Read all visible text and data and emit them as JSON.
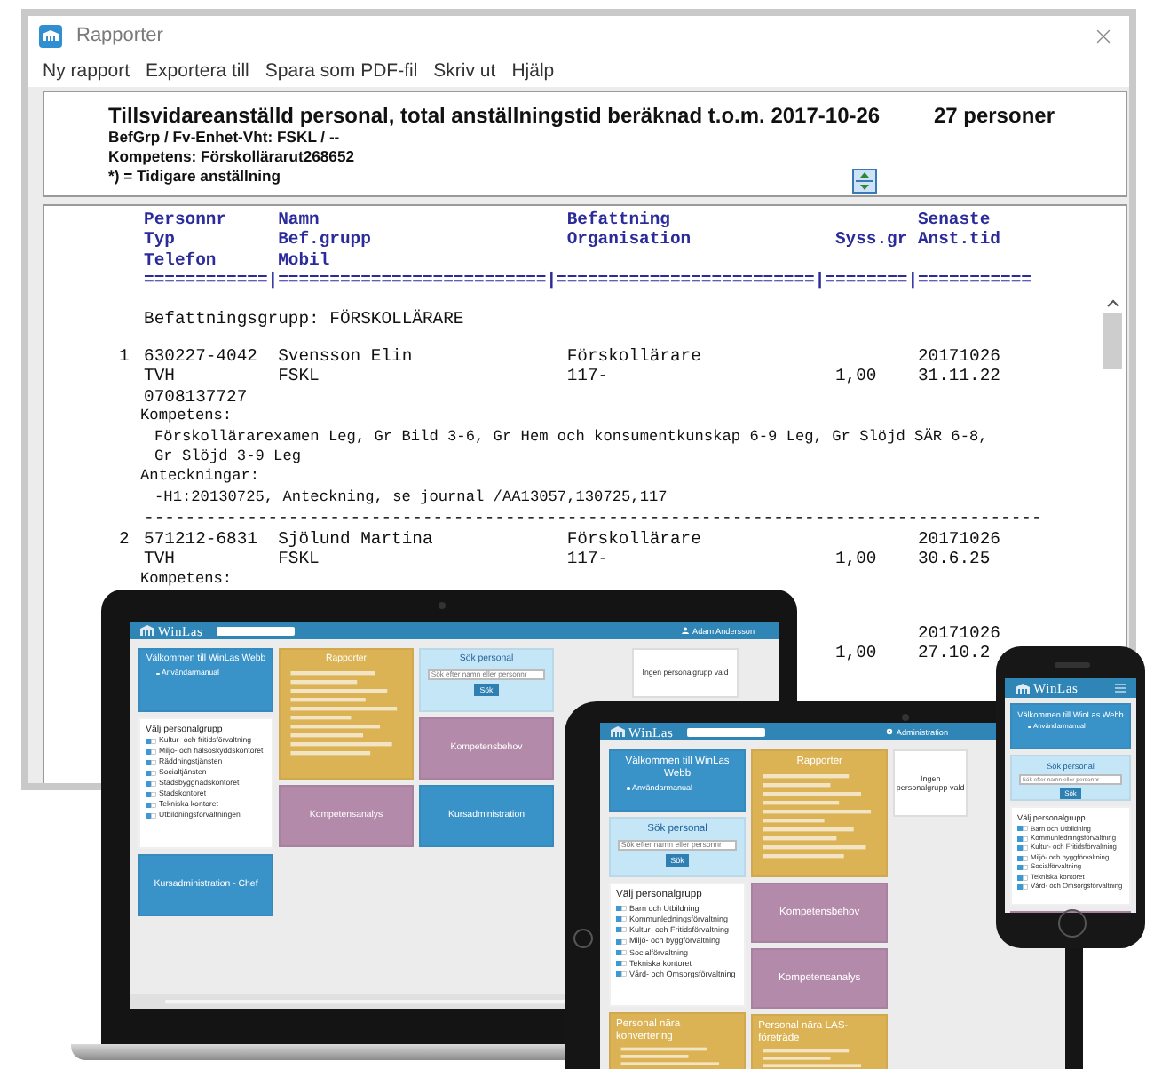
{
  "window": {
    "title": "Rapporter",
    "menu": [
      "Ny rapport",
      "Exportera till",
      "Spara som PDF-fil",
      "Skriv ut",
      "Hjälp"
    ]
  },
  "header": {
    "title": "Tillsvidareanställd personal, total anställningstid beräknad t.o.m. 2017-10-26",
    "count": "27 personer",
    "lines": [
      "BefGrp / Fv-Enhet-Vht: FSKL / --",
      "Kompetens: Förskollärarut268652",
      "*) = Tidigare anställning"
    ]
  },
  "report": {
    "header_lines": [
      {
        "personnr": "Personnr",
        "namn": "Namn",
        "befattning": "Befattning",
        "senaste": "Senaste"
      },
      {
        "personnr": "Typ",
        "namn": "Bef.grupp",
        "befattning": "Organisation",
        "syss": "Syss.gr",
        "senaste": "Anst.tid"
      },
      {
        "personnr": "Telefon",
        "namn": "Mobil"
      }
    ],
    "rule": "============|==========================|=========================|========|===========",
    "group": "Befattningsgrupp: FÖRSKOLLÄRARE",
    "persons": [
      {
        "number": "1",
        "lines": [
          {
            "personnr": "630227-4042",
            "namn": "Svensson Elin",
            "befattning": "Förskollärare",
            "senaste": "20171026"
          },
          {
            "personnr": "TVH",
            "namn": "FSKL",
            "befattning": "117-",
            "syss": "1,00",
            "senaste": "31.11.22"
          },
          {
            "personnr": "0708137727"
          }
        ],
        "sections": [
          {
            "label": "Kompetens:",
            "text": [
              "Förskollärarexamen Leg, Gr Bild 3-6, Gr Hem och konsumentkunskap 6-9 Leg, Gr Slöjd SÄR 6-8,",
              "Gr Slöjd 3-9 Leg"
            ]
          },
          {
            "label": "Anteckningar:",
            "text": [
              "-H1:20130725, Anteckning, se journal /AA13057,130725,117"
            ]
          }
        ],
        "divider": "---------------------------------------------------------------------------------------"
      },
      {
        "number": "2",
        "lines": [
          {
            "personnr": "571212-6831",
            "namn": "Sjölund Martina",
            "befattning": "Förskollärare",
            "senaste": "20171026"
          },
          {
            "personnr": "TVH",
            "namn": "FSKL",
            "befattning": "117-",
            "syss": "1,00",
            "senaste": "30.6.25"
          }
        ],
        "sections": [
          {
            "label": "Kompetens:"
          }
        ]
      },
      {
        "lines": [
          {
            "senaste": "20171026"
          },
          {
            "syss": "1,00",
            "senaste": "27.10.2"
          }
        ]
      }
    ]
  },
  "devices": [
    {
      "kind": "laptop",
      "logo": "WinLas",
      "user": "Adam Andersson",
      "columns": [
        [
          {
            "kind": "welcome",
            "title": "Välkommen till WinLas Webb",
            "color": "#3a93c8",
            "items": [
              "Användarmanual"
            ]
          },
          {
            "kind": "list",
            "title": "Välj personalgrupp",
            "color": "#ffffff",
            "items": [
              "Kultur- och fritidsförvaltning",
              "Miljö- och hälsoskyddskontoret",
              "Räddningstjänsten",
              "Socialtjänsten",
              "Stadsbyggnadskontoret",
              "Stadskontoret",
              "Tekniska kontoret",
              "Utbildningsförvaltningen"
            ]
          },
          {
            "kind": "tile",
            "title": "Kursadministration - Chef",
            "color": "#3a93c8"
          }
        ],
        [
          {
            "kind": "menu",
            "title": "Rapporter",
            "color": "#dcb354"
          },
          {
            "kind": "tile",
            "title": "Kompetensanalys",
            "color": "#b48aaa"
          }
        ],
        [
          {
            "kind": "search",
            "title": "Sök personal",
            "color": "#c5e6f7",
            "placeholder": "Sök efter namn eller personnr",
            "button": "Sök"
          },
          {
            "kind": "tile",
            "title": "Kompetensbehov",
            "color": "#b48aaa"
          },
          {
            "kind": "tile",
            "title": "Kursadministration",
            "color": "#3a93c8"
          }
        ]
      ],
      "note": "Ingen personalgrupp vald"
    },
    {
      "kind": "tablet",
      "logo": "WinLas",
      "admin": "Administration",
      "columns": [
        [
          {
            "kind": "welcome",
            "title": "Välkommen till WinLas Webb",
            "color": "#3a93c8",
            "items": [
              "Användarmanual"
            ]
          },
          {
            "kind": "search",
            "title": "Sök personal",
            "color": "#c5e6f7",
            "placeholder": "Sök efter namn eller personnr",
            "button": "Sök"
          },
          {
            "kind": "list",
            "title": "Välj personalgrupp",
            "color": "#ffffff",
            "items": [
              "Barn och Utbildning",
              "Kommunledningsförvaltning",
              "Kultur- och Fritidsförvaltning",
              "Miljö- och byggförvaltning",
              "Socialförvaltning",
              "Tekniska kontoret",
              "Vård- och Omsorgsförvaltning"
            ]
          },
          {
            "kind": "table",
            "title": "Personal nära konvertering",
            "color": "#dcb354"
          }
        ],
        [
          {
            "kind": "menu",
            "title": "Rapporter",
            "color": "#dcb354"
          },
          {
            "kind": "tile",
            "title": "Kompetensbehov",
            "color": "#b48aaa"
          },
          {
            "kind": "tile",
            "title": "Kompetensanalys",
            "color": "#b48aaa"
          },
          {
            "kind": "table",
            "title": "Personal nära LAS-företräde",
            "color": "#dcb354"
          }
        ]
      ],
      "note": "Ingen personalgrupp vald"
    },
    {
      "kind": "phone",
      "logo": "WinLas",
      "columns": [
        [
          {
            "kind": "welcome",
            "title": "Välkommen till WinLas Webb",
            "color": "#3a93c8",
            "items": [
              "Användarmanual"
            ]
          },
          {
            "kind": "search",
            "title": "Sök personal",
            "color": "#c5e6f7",
            "placeholder": "Sök efter namn eller personnr",
            "button": "Sök"
          },
          {
            "kind": "list",
            "title": "Välj personalgrupp",
            "color": "#ffffff",
            "items": [
              "Barn och Utbildning",
              "Kommunledningsförvaltning",
              "Kultur- och Fritidsförvaltning",
              "Miljö- och byggförvaltning",
              "Socialförvaltning",
              "Tekniska kontoret",
              "Vård- och Omsorgsförvaltning"
            ]
          },
          {
            "kind": "tile",
            "color": "#b48aaa"
          }
        ]
      ]
    }
  ]
}
